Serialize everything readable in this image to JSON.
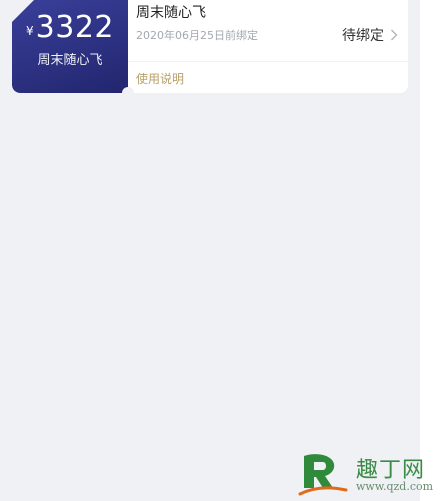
{
  "coupon": {
    "currency_symbol": "¥",
    "amount": "3322",
    "card_name": "周末随心飞",
    "title": "周末随心飞",
    "deadline": "2020年06月25日前绑定",
    "bind_status": "待绑定",
    "instructions_link": "使用说明",
    "colors": {
      "card_gradient_start": "#3a3f9a",
      "card_gradient_end": "#22266e",
      "instructions_text": "#b8a069",
      "page_background": "#eff1f5"
    },
    "icons": {
      "status_chevron": "chevron-right-icon"
    }
  },
  "watermark": {
    "brand_text": "趣丁网",
    "url": "www.qzd.com",
    "logo_icon": "brand-logo-icon"
  }
}
